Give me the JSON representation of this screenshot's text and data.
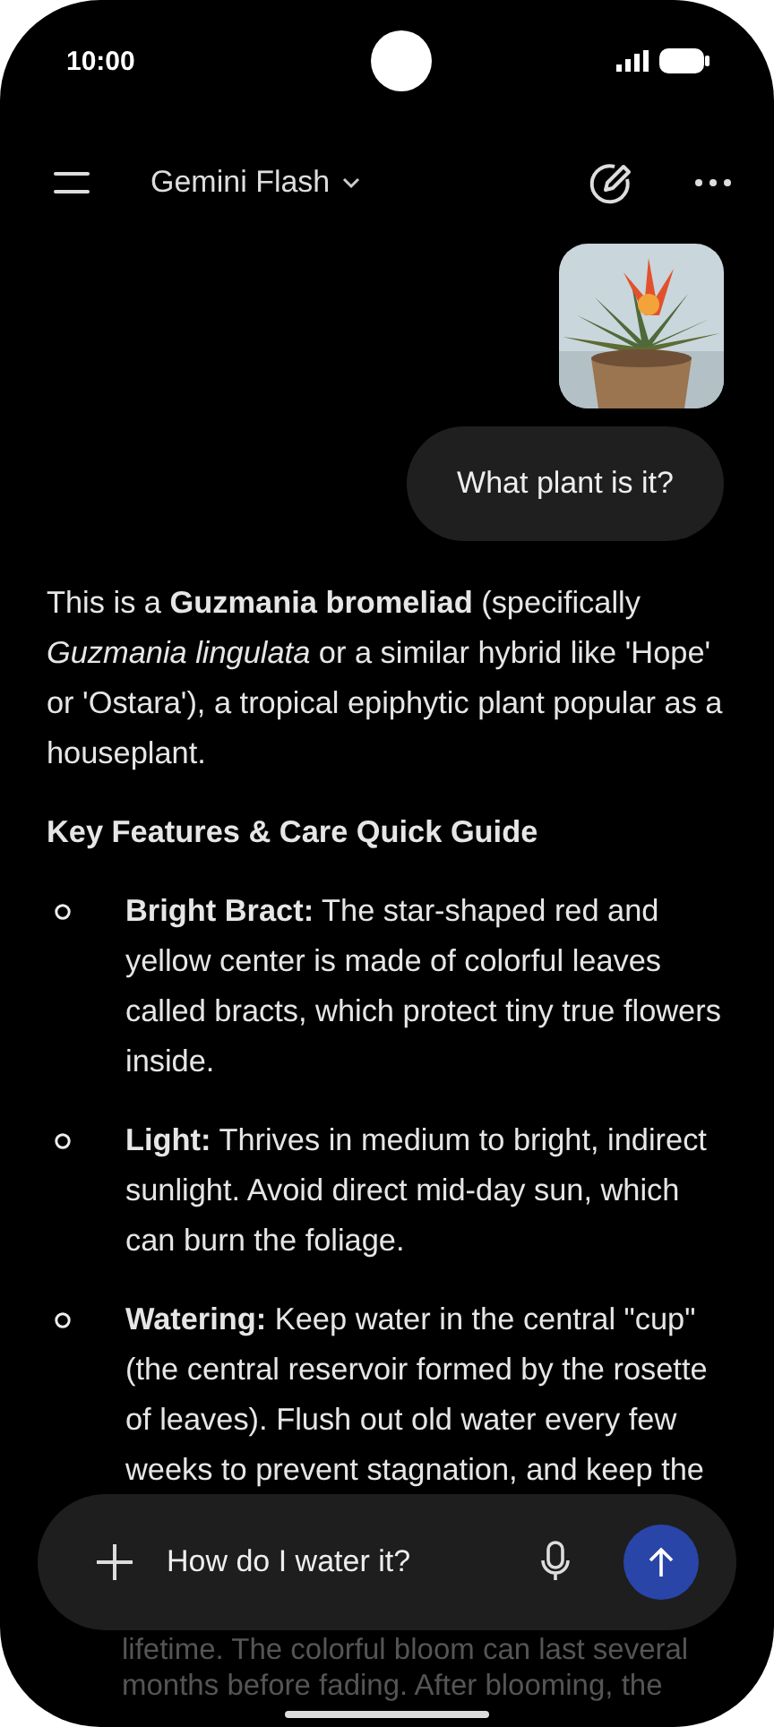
{
  "status": {
    "time": "10:00"
  },
  "header": {
    "model": "Gemini Flash"
  },
  "user_message": {
    "text": "What plant is it?"
  },
  "response": {
    "intro": "This is a **Guzmania bromeliad** (specifically *Guzmania lingulata* or a similar hybrid like 'Hope' or 'Ostara'), a tropical epiphytic plant popular as a houseplant.",
    "heading": "Key Features & Care Quick Guide",
    "items": [
      {
        "text": "**Bright Bract:** The star-shaped red and yellow center is made of colorful leaves called bracts, which protect tiny true flowers inside."
      },
      {
        "text": "**Light:** Thrives in medium to bright, indirect sunlight. Avoid direct mid-day sun, which can burn the foliage."
      },
      {
        "text": "**Watering:** Keep water in the central \"cup\" (the central reservoir formed by the rosette of leaves). Flush out old water every few weeks to prevent stagnation, and keep the"
      }
    ],
    "faded_text": "lifetime. The colorful bloom can last several months before fading. After blooming, the"
  },
  "composer": {
    "value": "How do I water it?"
  }
}
